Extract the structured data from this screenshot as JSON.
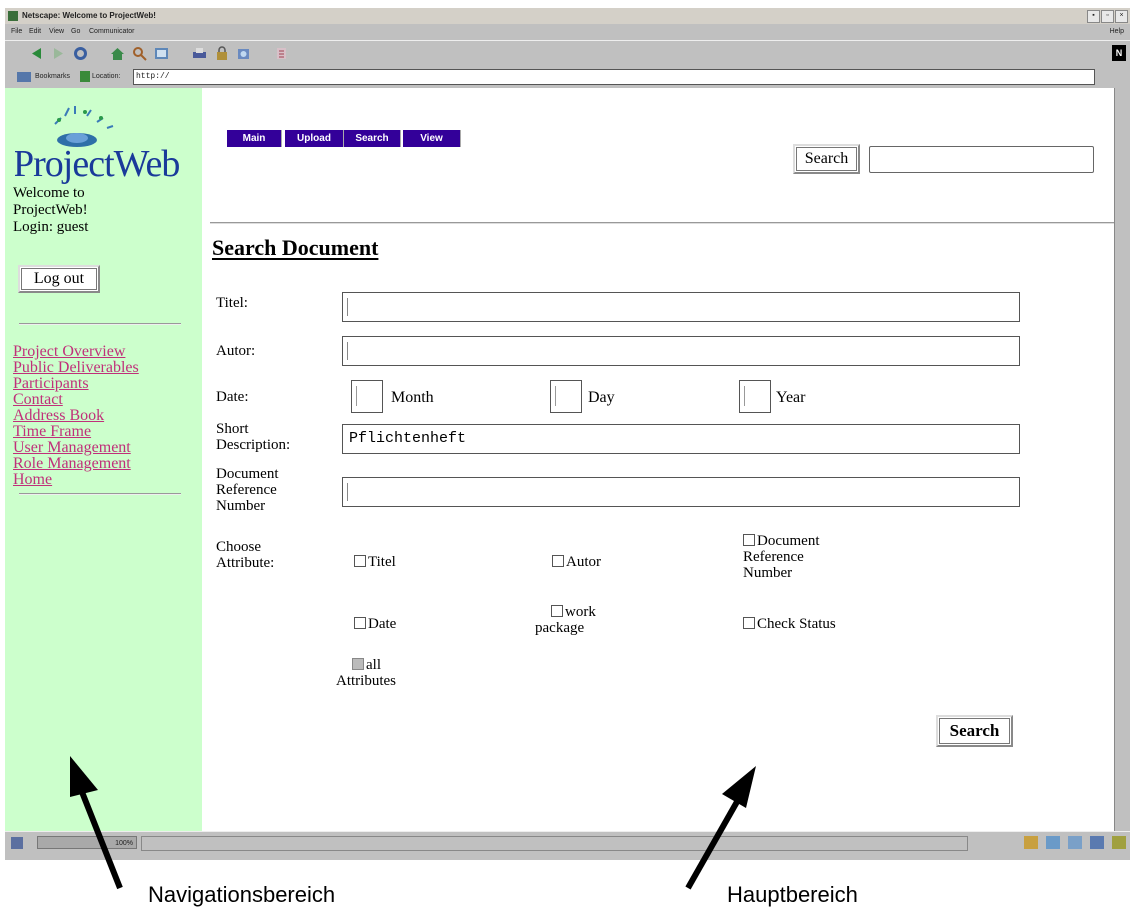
{
  "browser": {
    "window_title": "Netscape: Welcome to ProjectWeb!",
    "menu": [
      "File",
      "Edit",
      "View",
      "Go",
      "Communicator"
    ],
    "help_menu": "Help",
    "bookmarks_label": "Bookmarks",
    "location_label": "Location:",
    "url": "http://",
    "zoom": "100%",
    "brand_glyph": "N"
  },
  "nav": {
    "logo_text": "ProjectWeb",
    "welcome": [
      "Welcome to",
      "ProjectWeb!"
    ],
    "login": "Login: guest",
    "logout_label": "Log out",
    "links": [
      "Project Overview",
      "Public Deliverables",
      "Participants",
      "Contact",
      "Address Book",
      "Time Frame",
      "User Management",
      "Role Management",
      "Home"
    ],
    "link_color": "#c0307a",
    "bg_color": "#ccffcc"
  },
  "main": {
    "tabs": [
      "Main",
      "Upload",
      "Search",
      "View"
    ],
    "tab_color": "#330099",
    "search_button": "Search",
    "title": "Search Document",
    "form": {
      "titel_label": "Titel:",
      "autor_label": "Autor:",
      "date_label": "Date:",
      "month_label": "Month",
      "day_label": "Day",
      "year_label": "Year",
      "short_desc_label": [
        "Short",
        "Description:"
      ],
      "short_desc_value": "Pflichtenheft",
      "docref_label": [
        "Document",
        "Reference",
        "Number"
      ],
      "choose_label": [
        "Choose",
        "Attribute:"
      ]
    },
    "attributes": {
      "titel": "Titel",
      "autor": "Autor",
      "docref": [
        "Document",
        "Reference",
        "Number"
      ],
      "date": "Date",
      "work_package": [
        "work",
        "package"
      ],
      "check_status": "Check Status",
      "all": [
        "all",
        "Attributes"
      ]
    },
    "search_bottom": "Search"
  },
  "annotations": {
    "nav_area": "Navigationsbereich",
    "main_area": "Hauptbereich"
  }
}
